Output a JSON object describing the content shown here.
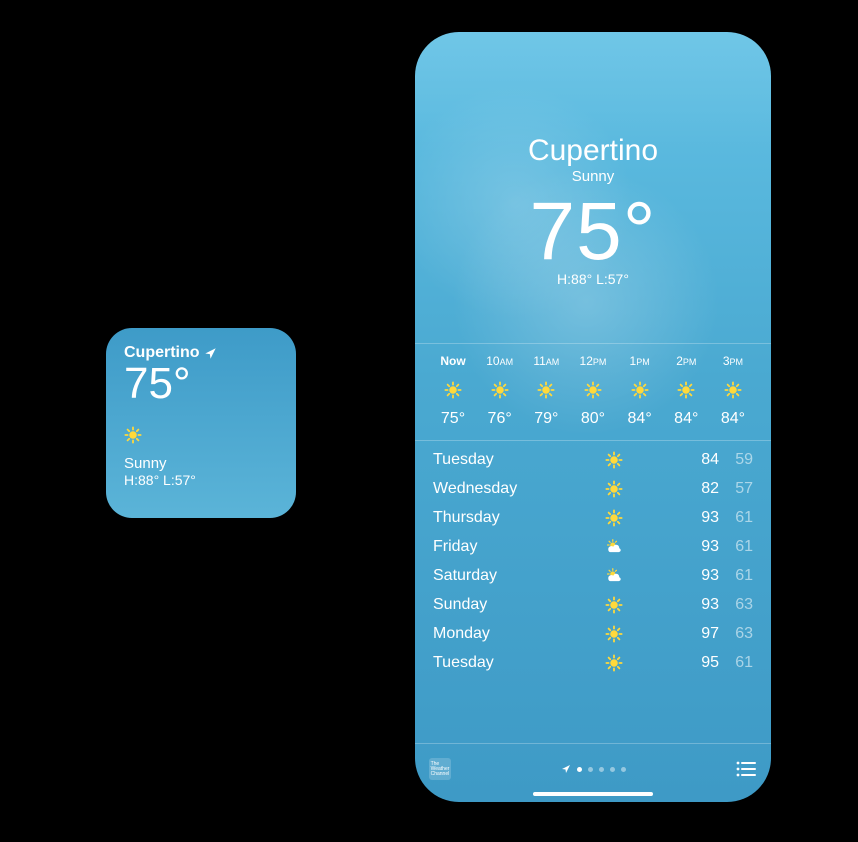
{
  "widget": {
    "location": "Cupertino",
    "temp": "75°",
    "condition": "Sunny",
    "high_low": "H:88°  L:57°"
  },
  "phone": {
    "city": "Cupertino",
    "condition": "Sunny",
    "temp": "75°",
    "high_low": "H:88° L:57°",
    "hourly": [
      {
        "label": "Now",
        "ampm": "",
        "temp": "75°",
        "icon": "sun"
      },
      {
        "label": "10",
        "ampm": "AM",
        "temp": "76°",
        "icon": "sun"
      },
      {
        "label": "11",
        "ampm": "AM",
        "temp": "79°",
        "icon": "sun"
      },
      {
        "label": "12",
        "ampm": "PM",
        "temp": "80°",
        "icon": "sun"
      },
      {
        "label": "1",
        "ampm": "PM",
        "temp": "84°",
        "icon": "sun"
      },
      {
        "label": "2",
        "ampm": "PM",
        "temp": "84°",
        "icon": "sun"
      },
      {
        "label": "3",
        "ampm": "PM",
        "temp": "84°",
        "icon": "sun"
      }
    ],
    "daily": [
      {
        "day": "Tuesday",
        "icon": "sun",
        "hi": "84",
        "lo": "59"
      },
      {
        "day": "Wednesday",
        "icon": "sun",
        "hi": "82",
        "lo": "57"
      },
      {
        "day": "Thursday",
        "icon": "sun",
        "hi": "93",
        "lo": "61"
      },
      {
        "day": "Friday",
        "icon": "partly-cloudy",
        "hi": "93",
        "lo": "61"
      },
      {
        "day": "Saturday",
        "icon": "partly-cloudy",
        "hi": "93",
        "lo": "61"
      },
      {
        "day": "Sunday",
        "icon": "sun",
        "hi": "93",
        "lo": "63"
      },
      {
        "day": "Monday",
        "icon": "sun",
        "hi": "97",
        "lo": "63"
      },
      {
        "day": "Tuesday",
        "icon": "sun",
        "hi": "95",
        "lo": "61"
      }
    ],
    "pager": {
      "count": 5,
      "current": 0,
      "has_location_page": true
    }
  }
}
